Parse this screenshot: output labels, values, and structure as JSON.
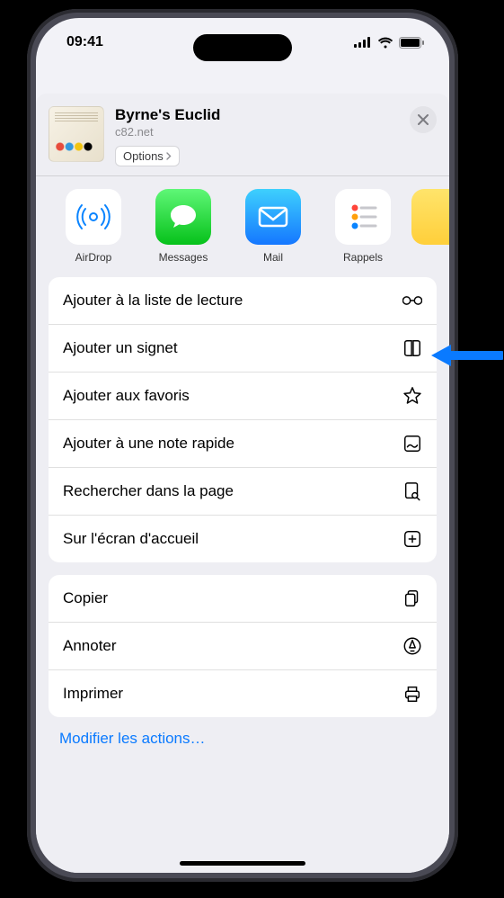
{
  "status": {
    "time": "09:41"
  },
  "header": {
    "title": "Byrne's Euclid",
    "subtitle": "c82.net",
    "options_label": "Options"
  },
  "share_apps": [
    {
      "name": "airdrop",
      "label": "AirDrop"
    },
    {
      "name": "messages",
      "label": "Messages"
    },
    {
      "name": "mail",
      "label": "Mail"
    },
    {
      "name": "rappels",
      "label": "Rappels"
    },
    {
      "name": "notes",
      "label": ""
    }
  ],
  "actions_primary": [
    {
      "key": "reading-list",
      "label": "Ajouter à la liste de lecture",
      "icon": "glasses-icon"
    },
    {
      "key": "bookmark",
      "label": "Ajouter un signet",
      "icon": "book-icon"
    },
    {
      "key": "favorite",
      "label": "Ajouter aux favoris",
      "icon": "star-icon"
    },
    {
      "key": "quick-note",
      "label": "Ajouter à une note rapide",
      "icon": "quicknote-icon"
    },
    {
      "key": "find",
      "label": "Rechercher dans la page",
      "icon": "doc-search-icon"
    },
    {
      "key": "home-screen",
      "label": "Sur l'écran d'accueil",
      "icon": "plus-app-icon"
    }
  ],
  "actions_secondary": [
    {
      "key": "copy",
      "label": "Copier",
      "icon": "doc-on-doc-icon"
    },
    {
      "key": "markup",
      "label": "Annoter",
      "icon": "markup-icon"
    },
    {
      "key": "print",
      "label": "Imprimer",
      "icon": "printer-icon"
    }
  ],
  "edit_label": "Modifier les actions…",
  "callout_target": "reading-list"
}
